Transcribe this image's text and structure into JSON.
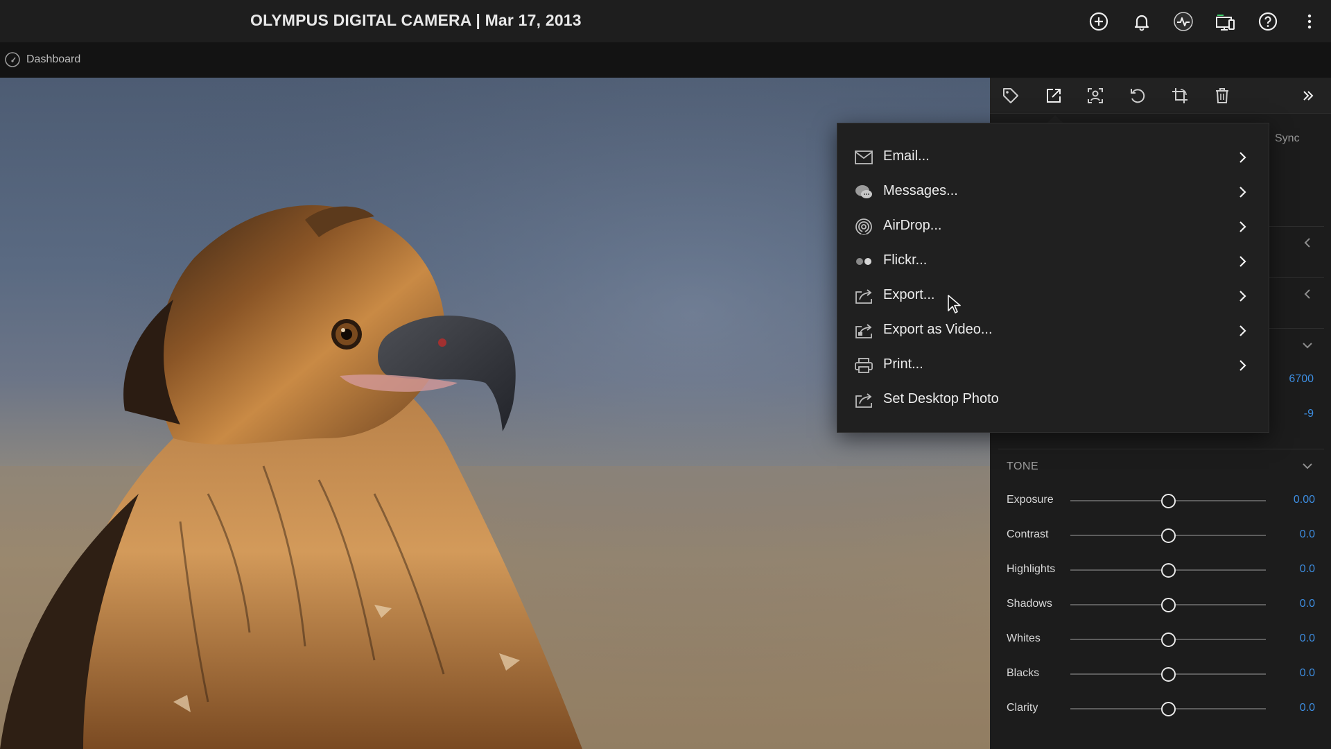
{
  "app": {
    "title": "OLYMPUS DIGITAL CAMERA | Mar 17, 2013",
    "breadcrumb": "Dashboard"
  },
  "topbar": {
    "icons": [
      "add-circle-icon",
      "bell-icon",
      "activity-icon",
      "devices-icon",
      "help-icon",
      "more-vertical-icon"
    ]
  },
  "panel": {
    "toolbar_icons": [
      "tag-icon",
      "share-icon",
      "people-icon",
      "rotate-icon",
      "crop-icon",
      "trash-icon",
      "collapse-icon"
    ],
    "sync_label": "Sync",
    "temp_value": "6700",
    "tint_value": "-9",
    "tone": {
      "header": "TONE",
      "sliders": [
        {
          "label": "Exposure",
          "value": "0.00",
          "level": 0.5
        },
        {
          "label": "Contrast",
          "value": "0.0",
          "level": 0.5
        },
        {
          "label": "Highlights",
          "value": "0.0",
          "level": 0.5
        },
        {
          "label": "Shadows",
          "value": "0.0",
          "level": 0.5
        },
        {
          "label": "Whites",
          "value": "0.0",
          "level": 0.5
        },
        {
          "label": "Blacks",
          "value": "0.0",
          "level": 0.5
        },
        {
          "label": "Clarity",
          "value": "0.0",
          "level": 0.5
        }
      ]
    }
  },
  "share_menu": {
    "items": [
      {
        "label": "Email...",
        "icon": "envelope-icon",
        "has_submenu": true
      },
      {
        "label": "Messages...",
        "icon": "messages-icon",
        "has_submenu": true
      },
      {
        "label": "AirDrop...",
        "icon": "airdrop-icon",
        "has_submenu": true
      },
      {
        "label": "Flickr...",
        "icon": "flickr-icon",
        "has_submenu": true
      },
      {
        "label": "Export...",
        "icon": "export-icon",
        "has_submenu": true
      },
      {
        "label": "Export as Video...",
        "icon": "export-video-icon",
        "has_submenu": true
      },
      {
        "label": "Print...",
        "icon": "printer-icon",
        "has_submenu": true
      },
      {
        "label": "Set Desktop Photo",
        "icon": "desktop-photo-icon",
        "has_submenu": false
      }
    ]
  },
  "colors": {
    "accent": "#3d8de0",
    "topbar_bg": "#1e1e1e",
    "panel_bg": "#1c1c1c",
    "menu_bg": "#202020"
  }
}
